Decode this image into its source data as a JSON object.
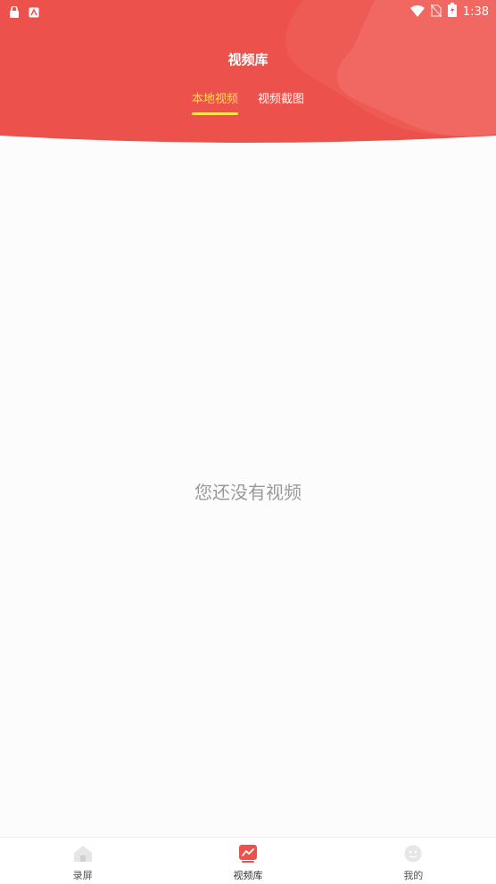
{
  "status_bar": {
    "time": "1:38",
    "left_icons": [
      "lock-notification-icon",
      "app-notification-icon"
    ],
    "right_icons": [
      "wifi-icon",
      "no-sim-icon",
      "battery-charging-icon"
    ]
  },
  "header": {
    "title": "视频库",
    "background_color": "#ec514c",
    "tabs": [
      {
        "label": "本地视频",
        "active": true
      },
      {
        "label": "视频截图",
        "active": false
      }
    ],
    "active_tab_color": "#ffe14a"
  },
  "main": {
    "empty_message": "您还没有视频"
  },
  "bottom_nav": {
    "items": [
      {
        "label": "录屏",
        "icon": "home-icon",
        "active": false
      },
      {
        "label": "视频库",
        "icon": "chart-icon",
        "active": true
      },
      {
        "label": "我的",
        "icon": "profile-face-icon",
        "active": false
      }
    ],
    "active_color": "#ec514c"
  }
}
